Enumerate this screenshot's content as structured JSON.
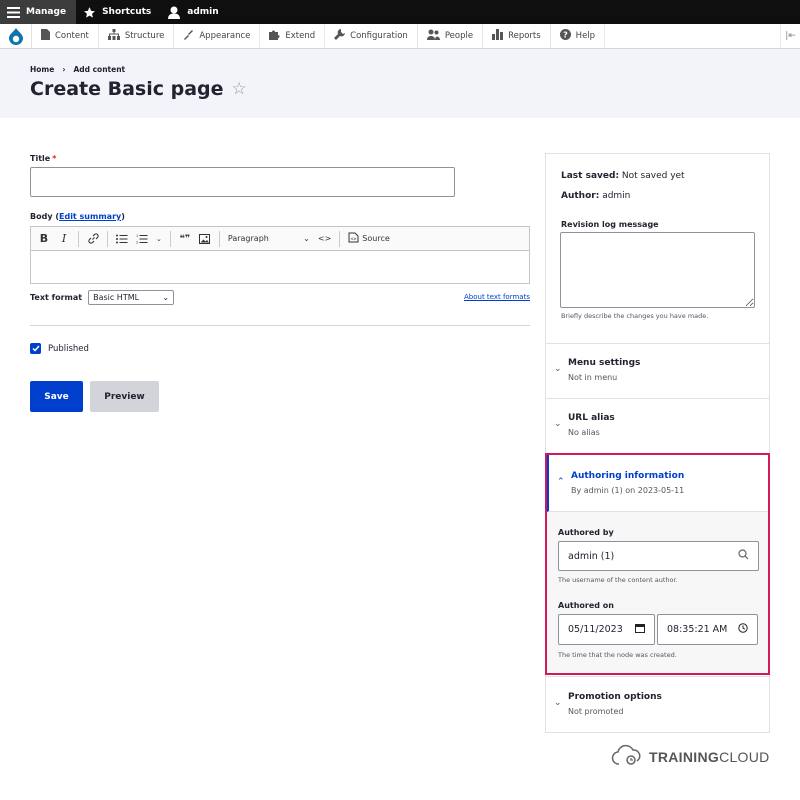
{
  "toolbar": {
    "manage_label": "Manage",
    "shortcuts_label": "Shortcuts",
    "user_label": "admin"
  },
  "admin_menu": {
    "items": [
      {
        "label": "Content",
        "icon": "file-icon"
      },
      {
        "label": "Structure",
        "icon": "sitemap-icon"
      },
      {
        "label": "Appearance",
        "icon": "paintbrush-icon"
      },
      {
        "label": "Extend",
        "icon": "puzzle-icon"
      },
      {
        "label": "Configuration",
        "icon": "wrench-icon"
      },
      {
        "label": "People",
        "icon": "people-icon"
      },
      {
        "label": "Reports",
        "icon": "bar-chart-icon"
      },
      {
        "label": "Help",
        "icon": "help-icon"
      }
    ]
  },
  "header": {
    "breadcrumb": [
      "Home",
      "Add content"
    ],
    "breadcrumb_sep": "›",
    "title": "Create Basic page",
    "star": "☆"
  },
  "form": {
    "title_label": "Title",
    "required_mark": "*",
    "title_value": "",
    "body_label": "Body",
    "edit_summary_link": "Edit summary",
    "editor": {
      "bold": "B",
      "italic": "I",
      "paragraph": "Paragraph",
      "source": "Source",
      "code": "<>",
      "quote": "❝❞"
    },
    "text_format_label": "Text format",
    "text_format_value": "Basic HTML",
    "about_text_formats": "About text formats",
    "published_label": "Published",
    "published_checked": true,
    "save_label": "Save",
    "preview_label": "Preview"
  },
  "sidebar": {
    "last_saved_label": "Last saved:",
    "last_saved_value": "Not saved yet",
    "author_label": "Author:",
    "author_value": "admin",
    "revision_label": "Revision log message",
    "revision_value": "",
    "revision_desc": "Briefly describe the changes you have made.",
    "menu_settings": {
      "title": "Menu settings",
      "summary": "Not in menu"
    },
    "url_alias": {
      "title": "URL alias",
      "summary": "No alias"
    },
    "authoring": {
      "title": "Authoring information",
      "summary": "By admin (1) on 2023-05-11",
      "authored_by_label": "Authored by",
      "authored_by_value": "admin (1)",
      "authored_by_desc": "The username of the content author.",
      "authored_on_label": "Authored on",
      "date_value": "05/11/2023",
      "time_value": "08:35:21 AM",
      "authored_on_desc": "The time that the node was created."
    },
    "promotion": {
      "title": "Promotion options",
      "summary": "Not promoted"
    }
  },
  "brand": {
    "bold": "TRAINING",
    "regular": "CLOUD"
  },
  "colors": {
    "primary": "#003ecc",
    "highlight": "#d5175e",
    "toolbar_bg": "#0f0f0f",
    "header_bg": "#f3f4f9"
  }
}
